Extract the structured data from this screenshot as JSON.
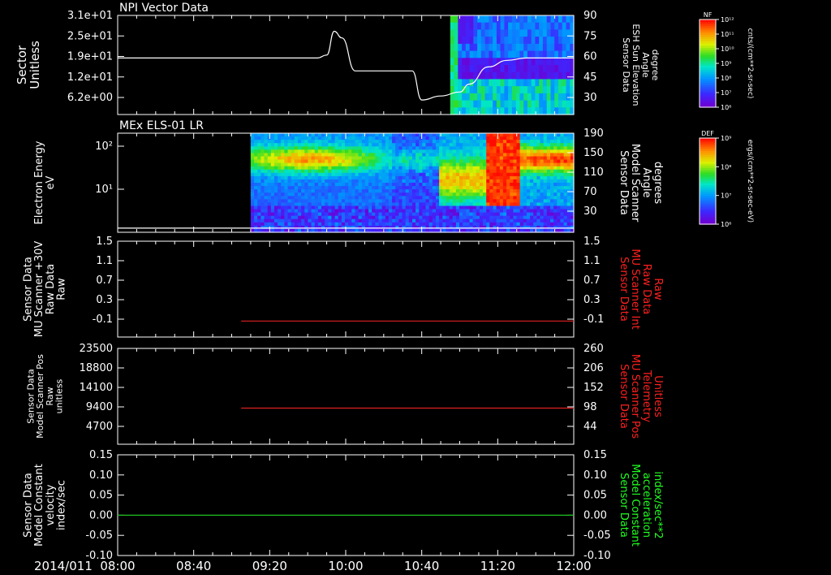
{
  "date_label": "2014/011",
  "time_ticks": [
    "08:00",
    "08:40",
    "09:20",
    "10:00",
    "10:40",
    "11:20",
    "12:00"
  ],
  "colors": {
    "background": "#000000",
    "axis": "#ffffff",
    "red_series": "#e02020",
    "green_series": "#20c020",
    "red_label": "#ff2020",
    "green_label": "#20ff20"
  },
  "colorbars": [
    {
      "title": "NF",
      "ticks": [
        "10¹²",
        "10¹¹",
        "10¹⁰",
        "10⁹",
        "10⁸",
        "10⁷",
        "10⁶"
      ],
      "unit": "cnts/(cm**2-sr-sec)"
    },
    {
      "title": "DEF",
      "ticks": [
        "10⁹",
        "10⁸",
        "10⁷",
        "10⁶"
      ],
      "unit": "ergs/(cm**2-sr-sec-eV)"
    }
  ],
  "chart_data": [
    {
      "type": "line",
      "title": "NPI Vector Data",
      "left_label": [
        "Sector",
        "Unitless"
      ],
      "right_label": [
        "Sensor Data",
        "ESH Sun Elevation",
        "Angle",
        "degree"
      ],
      "left_ticks": [
        "3.1e+01",
        "2.5e+01",
        "1.9e+01",
        "1.2e+01",
        "6.2e+00"
      ],
      "right_ticks": [
        "90",
        "75",
        "60",
        "45",
        "30"
      ],
      "right_ylim": [
        15,
        90
      ],
      "spectrogram": {
        "x_start": "10:55",
        "x_end": "12:00"
      },
      "series": [
        {
          "name": "ESH Sun Elevation Angle",
          "x": [
            "08:00",
            "09:45",
            "09:50",
            "09:54",
            "09:58",
            "10:05",
            "10:20",
            "10:35",
            "10:40",
            "10:50",
            "11:00",
            "11:05",
            "11:15",
            "11:25",
            "11:35",
            "12:00"
          ],
          "y": [
            57.8,
            57.8,
            60,
            78,
            73,
            48,
            48,
            48,
            26,
            29,
            32,
            38,
            51,
            56,
            57.8,
            57.8
          ]
        }
      ]
    },
    {
      "type": "heatmap",
      "title": "MEx ELS-01 LR",
      "left_label": [
        "Electron Energy",
        "eV"
      ],
      "right_label": [
        "Sensor Data",
        "Model Scanner",
        "Angle",
        "degrees"
      ],
      "left_ticks": [
        "10²",
        "10¹"
      ],
      "right_ticks": [
        "190",
        "150",
        "110",
        "70",
        "30"
      ],
      "right_ylim": [
        0,
        190
      ],
      "data_start": "09:10",
      "data_end": "12:00",
      "series": [
        {
          "name": "Model Scanner Angle",
          "x": [
            "08:00",
            "12:00"
          ],
          "y": [
            8,
            8
          ]
        }
      ]
    },
    {
      "type": "line",
      "left_label": [
        "Sensor Data",
        "MU Scanner +30V",
        "Raw Data",
        "Raw"
      ],
      "right_label": [
        "Sensor Data",
        "MU Scanner Int",
        "Raw Data",
        "Raw"
      ],
      "left_ticks": [
        "1.5",
        "1.1",
        "0.7",
        "0.3",
        "-0.1"
      ],
      "right_ticks": [
        "1.5",
        "1.1",
        "0.7",
        "0.3",
        "-0.1"
      ],
      "ylim": [
        -0.3,
        1.5
      ],
      "series": [
        {
          "name": "MU Scanner Int Raw Data",
          "x": [
            "09:05",
            "12:00"
          ],
          "y": [
            0,
            0
          ]
        }
      ]
    },
    {
      "type": "line",
      "left_label": [
        "Sensor Data",
        "Model Scanner Pos",
        "Raw",
        "unitless"
      ],
      "right_label": [
        "Sensor Data",
        "MU Scanner Pos",
        "Telemetry",
        "Unitless"
      ],
      "left_ticks": [
        "23500",
        "18800",
        "14100",
        "9400",
        "4700"
      ],
      "right_ticks": [
        "260",
        "206",
        "152",
        "98",
        "44"
      ],
      "right_ylim": [
        0,
        260
      ],
      "series": [
        {
          "name": "MU Scanner Pos Telemetry",
          "x": [
            "09:05",
            "12:00"
          ],
          "y": [
            98,
            98
          ]
        }
      ]
    },
    {
      "type": "line",
      "left_label": [
        "Sensor Data",
        "Model Constant",
        "velocity",
        "index/sec"
      ],
      "right_label": [
        "Sensor Data",
        "Model Constant",
        "acceleration",
        "index/sec**2"
      ],
      "left_ticks": [
        "0.15",
        "0.10",
        "0.05",
        "0.00",
        "-0.05",
        "-0.10"
      ],
      "right_ticks": [
        "0.15",
        "0.10",
        "0.05",
        "0.00",
        "-0.05",
        "-0.10"
      ],
      "ylim": [
        -0.1,
        0.15
      ],
      "series": [
        {
          "name": "Model Constant acceleration",
          "x": [
            "08:00",
            "12:00"
          ],
          "y": [
            0.0,
            0.0
          ]
        }
      ]
    }
  ]
}
